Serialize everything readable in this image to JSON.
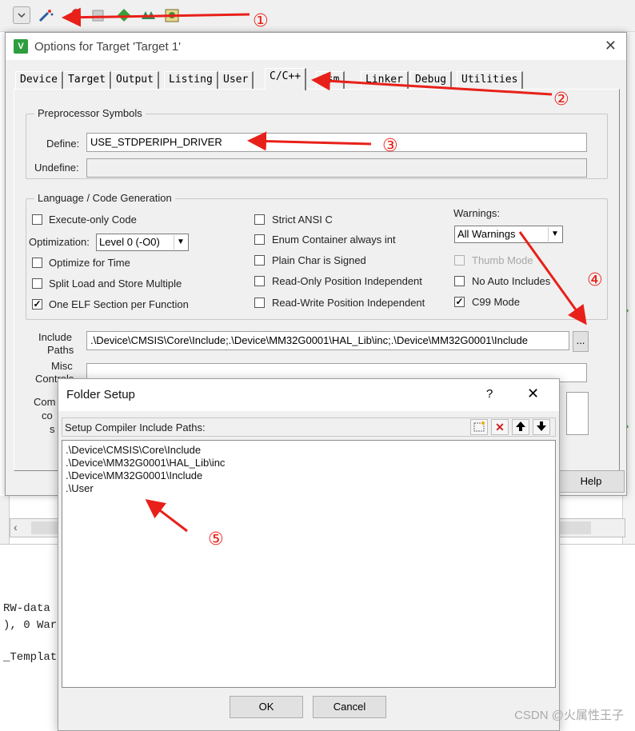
{
  "ide": {
    "code_lines": [
      "RW-data",
      "), 0 War",
      "_Templat"
    ],
    "help_button": "Help"
  },
  "options_dialog": {
    "title": "Options for Target 'Target 1'",
    "tabs": [
      "Device",
      "Target",
      "Output",
      "Listing",
      "User",
      "C/C++",
      "Asm",
      "Linker",
      "Debug",
      "Utilities"
    ],
    "active_tab": "C/C++",
    "preprocessor": {
      "group_title": "Preprocessor Symbols",
      "define_label": "Define:",
      "define_value": "USE_STDPERIPH_DRIVER",
      "undefine_label": "Undefine:",
      "undefine_value": ""
    },
    "language": {
      "group_title": "Language / Code Generation",
      "execute_only": "Execute-only Code",
      "optimization_label": "Optimization:",
      "optimization_value": "Level 0 (-O0)",
      "optimize_time": "Optimize for Time",
      "split_load": "Split Load and Store Multiple",
      "one_elf": "One ELF Section per Function",
      "strict_ansi": "Strict ANSI C",
      "enum_container": "Enum Container always int",
      "plain_char": "Plain Char is Signed",
      "ro_pi": "Read-Only Position Independent",
      "rw_pi": "Read-Write Position Independent",
      "warnings_label": "Warnings:",
      "warnings_value": "All Warnings",
      "thumb_mode": "Thumb Mode",
      "no_auto_includes": "No Auto Includes",
      "c99_mode": "C99 Mode"
    },
    "include_label_1": "Include",
    "include_label_2": "Paths",
    "include_value": ".\\Device\\CMSIS\\Core\\Include;.\\Device\\MM32G0001\\HAL_Lib\\inc;.\\Device\\MM32G0001\\Include",
    "browse": "...",
    "misc_label_1": "Misc",
    "misc_label_2": "Controls",
    "compiler_label_1": "Com",
    "compiler_label_2": "co",
    "compiler_label_3": "s"
  },
  "folder_setup": {
    "title": "Folder Setup",
    "help": "?",
    "close": "✕",
    "header": "Setup Compiler Include Paths:",
    "paths": [
      ".\\Device\\CMSIS\\Core\\Include",
      ".\\Device\\MM32G0001\\HAL_Lib\\inc",
      ".\\Device\\MM32G0001\\Include",
      ".\\User"
    ],
    "ok": "OK",
    "cancel": "Cancel"
  },
  "annotations": [
    "①",
    "②",
    "③",
    "④",
    "⑤"
  ],
  "watermark": "CSDN @火属性王子",
  "colors": {
    "annotation_red": "#e8201a",
    "dialog_bg": "#f0f0f0"
  }
}
